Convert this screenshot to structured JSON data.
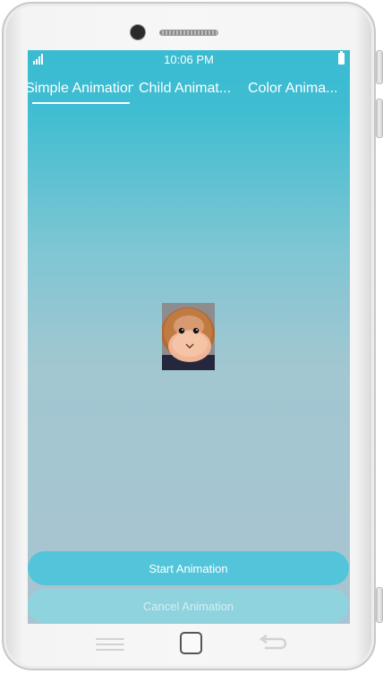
{
  "status_bar": {
    "time": "10:06 PM",
    "signal_icon": "signal-bars-icon",
    "battery_icon": "battery-icon"
  },
  "tabs": [
    {
      "label": "Simple Animation",
      "selected": true
    },
    {
      "label": "Child Animat...",
      "selected": false
    },
    {
      "label": "Color Anima...",
      "selected": false
    }
  ],
  "image": {
    "icon": "monkey-plush-image"
  },
  "buttons": {
    "start_label": "Start Animation",
    "cancel_label": "Cancel Animation",
    "cancel_enabled": false
  },
  "colors": {
    "accent": "#39bbd1",
    "button_primary": "#52c5da",
    "button_disabled": "#8fd3de",
    "text_on_accent": "#ffffff"
  },
  "device_keys": [
    "menu-key-icon",
    "home-key-icon",
    "back-key-icon"
  ]
}
